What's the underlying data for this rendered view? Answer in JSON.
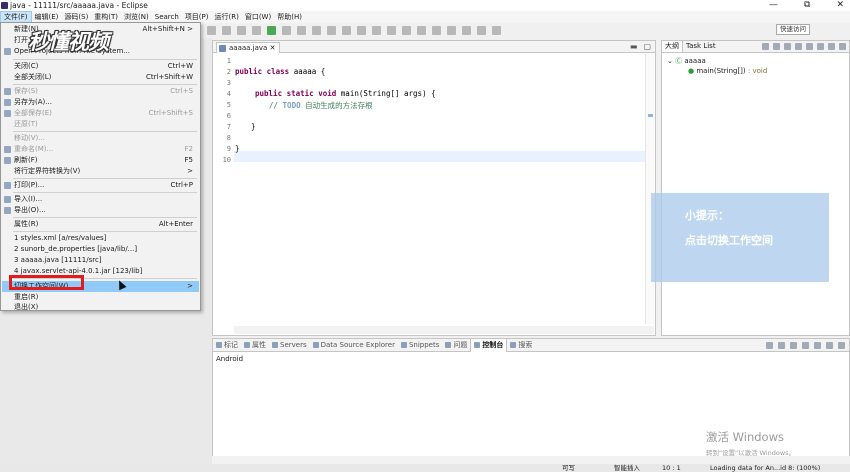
{
  "window": {
    "title": "java - 11111/src/aaaaa.java - Eclipse",
    "controls": [
      "—",
      "⧉",
      "✕"
    ]
  },
  "menubar": [
    "文件(F)",
    "编辑(E)",
    "源码(S)",
    "重构(T)",
    "浏览(N)",
    "Search",
    "项目(P)",
    "运行(R)",
    "窗口(W)",
    "帮助(H)"
  ],
  "quick_access": "快速访问",
  "file_menu": {
    "items": [
      {
        "label": "新建(N)",
        "shortcut": "Alt+Shift+N >",
        "disabled": false
      },
      {
        "label": "打开文",
        "shortcut": "",
        "disabled": false
      },
      {
        "label": "Open Projects from File System...",
        "shortcut": "",
        "disabled": false
      },
      {
        "label": "关闭(C)",
        "shortcut": "Ctrl+W",
        "disabled": false
      },
      {
        "label": "全部关闭(L)",
        "shortcut": "Ctrl+Shift+W",
        "disabled": false
      },
      {
        "label": "保存(S)",
        "shortcut": "Ctrl+S",
        "disabled": true
      },
      {
        "label": "另存为(A)...",
        "shortcut": "",
        "disabled": false
      },
      {
        "label": "全部保存(E)",
        "shortcut": "Ctrl+Shift+S",
        "disabled": true
      },
      {
        "label": "还原(T)",
        "shortcut": "",
        "disabled": true
      },
      {
        "label": "移动(V)...",
        "shortcut": "",
        "disabled": true
      },
      {
        "label": "重命名(M)...",
        "shortcut": "F2",
        "disabled": true
      },
      {
        "label": "刷新(F)",
        "shortcut": "F5",
        "disabled": false
      },
      {
        "label": "将行定界符转换为(V)",
        "shortcut": ">",
        "disabled": false
      },
      {
        "label": "打印(P)...",
        "shortcut": "Ctrl+P",
        "disabled": false
      },
      {
        "label": "导入(I)...",
        "shortcut": "",
        "disabled": false
      },
      {
        "label": "导出(O)...",
        "shortcut": "",
        "disabled": false
      },
      {
        "label": "属性(R)",
        "shortcut": "Alt+Enter",
        "disabled": false
      },
      {
        "label": "1 styles.xml  [a/res/values]",
        "shortcut": "",
        "disabled": false
      },
      {
        "label": "2 sunorb_de.properties  [java/lib/...]",
        "shortcut": "",
        "disabled": false
      },
      {
        "label": "3 aaaaa.java  [11111/src]",
        "shortcut": "",
        "disabled": false
      },
      {
        "label": "4 javax.servlet-api-4.0.1.jar  [123/lib]",
        "shortcut": "",
        "disabled": false
      },
      {
        "label": "切换工作空间(W)",
        "shortcut": ">",
        "disabled": false
      },
      {
        "label": "重启(R)",
        "shortcut": "",
        "disabled": false
      },
      {
        "label": "退出(X)",
        "shortcut": "",
        "disabled": false
      }
    ]
  },
  "editor": {
    "tab": "aaaaa.java",
    "lines": [
      "1",
      "2",
      "3",
      "4",
      "5",
      "6",
      "7",
      "8",
      "9",
      "10"
    ],
    "code": {
      "l2_kw": "public class ",
      "l2_rest": "aaaaa {",
      "l4_kw": "public static void ",
      "l4_rest": "main(String[] args) {",
      "l5_comment": "// ",
      "l5_todo": "TODO",
      "l5_text": " 自动生成的方法存根",
      "l7": "}",
      "l9": "}"
    }
  },
  "outline": {
    "tabs": [
      "大纲",
      "Task List"
    ],
    "class_name": "aaaaa",
    "method": "main(String[])",
    "method_type": " : void"
  },
  "console": {
    "tabs": [
      "标记",
      "属性",
      "Servers",
      "Data Source Explorer",
      "Snippets",
      "问题",
      "控制台",
      "搜索"
    ],
    "text": "Android"
  },
  "statusbar": {
    "writable": "可写",
    "insert_mode": "智能插入",
    "position": "10 : 1",
    "loading": "Loading data for An...id 8: (100%)"
  },
  "overlay": {
    "logo": "秒懂视频",
    "tip_title": "小提示：",
    "tip_body": "点击切换工作空间",
    "activate_title": "激活 Windows",
    "activate_sub": "转到\"设置\"以激活 Windows。"
  },
  "colors": {
    "accent": "#91c9f7",
    "highlight_box": "#e01c1c",
    "keyword": "#7f0055",
    "comment": "#3f7f5f"
  }
}
